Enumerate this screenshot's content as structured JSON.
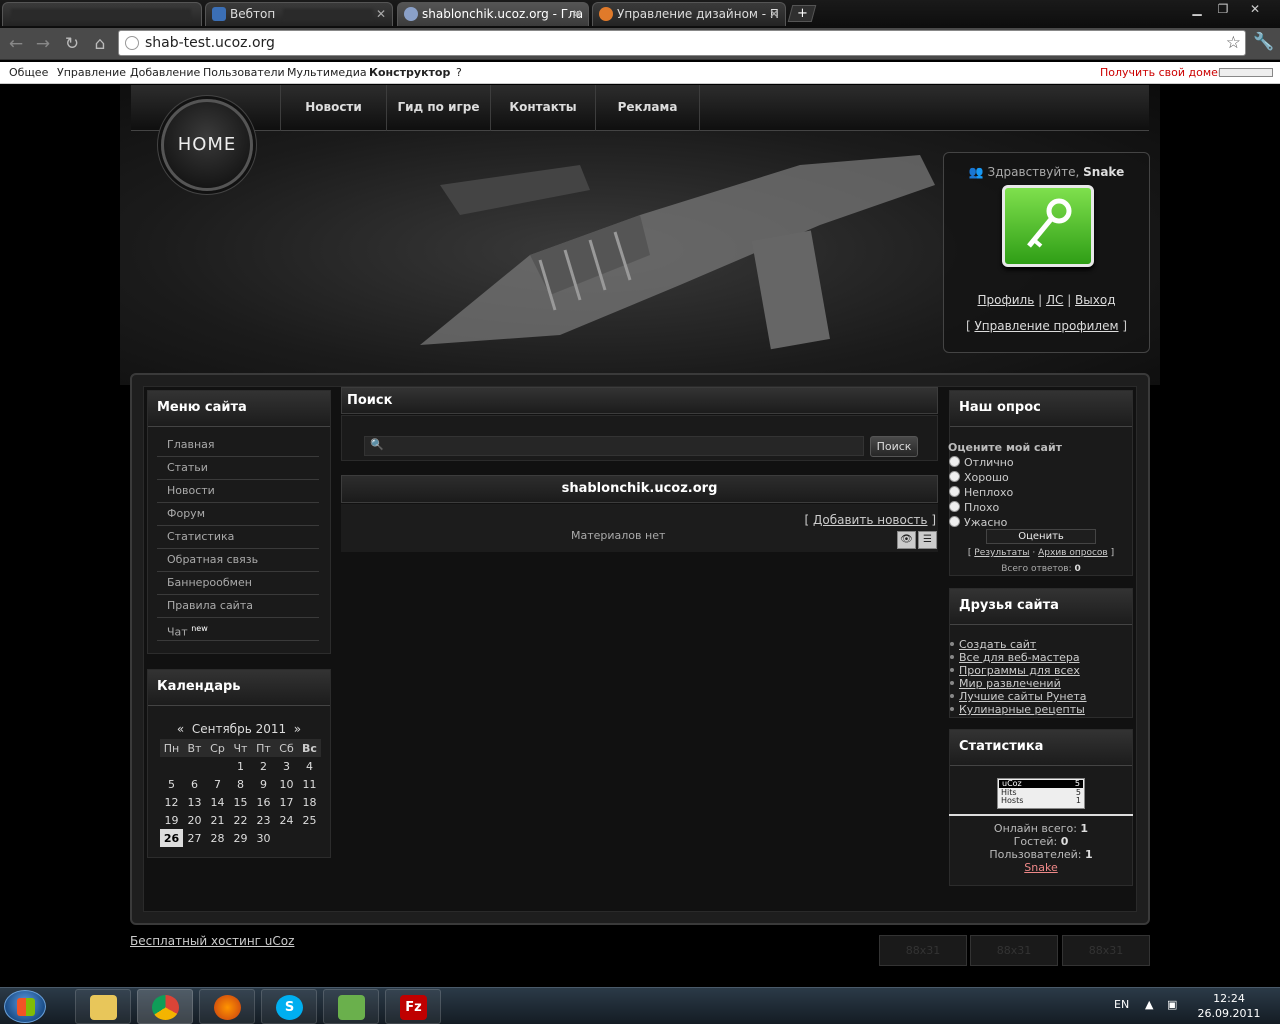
{
  "browser": {
    "tabs": [
      {
        "label": "",
        "active": false
      },
      {
        "label": "Вебтоп",
        "active": false
      },
      {
        "label": "shablonchik.ucoz.org - Гла",
        "active": true
      },
      {
        "label": "Управление дизайном - П",
        "active": false
      }
    ],
    "new_tab": "+",
    "url": "shab-test.ucoz.org"
  },
  "ucozbar": {
    "items": [
      "Общее",
      "Управление",
      "Добавление",
      "Пользователи",
      "Мультимедиа",
      "Конструктор",
      "?"
    ],
    "domain_link": "Получить свой домен"
  },
  "nav": {
    "home": "HOME",
    "items": [
      "Новости",
      "Гид по игре",
      "Контакты",
      "Реклама"
    ]
  },
  "login": {
    "greeting": "Здравствуйте,",
    "username": "Snake",
    "profile": "Профиль",
    "pm": "ЛС",
    "logout": "Выход",
    "manage": "Управление профилем"
  },
  "menu": {
    "title": "Меню сайта",
    "items": [
      "Главная",
      "Статьи",
      "Новости",
      "Форум",
      "Статистика",
      "Обратная связь",
      "Баннерообмен",
      "Правила сайта",
      "Чат"
    ],
    "chat_badge": "new"
  },
  "calendar": {
    "title": "Календарь",
    "prev": "«",
    "month": "Сентябрь 2011",
    "next": "»",
    "dow": [
      "Пн",
      "Вт",
      "Ср",
      "Чт",
      "Пт",
      "Сб",
      "Вс"
    ],
    "weeks": [
      [
        "",
        "",
        "",
        "1",
        "2",
        "3",
        "4"
      ],
      [
        "5",
        "6",
        "7",
        "8",
        "9",
        "10",
        "11"
      ],
      [
        "12",
        "13",
        "14",
        "15",
        "16",
        "17",
        "18"
      ],
      [
        "19",
        "20",
        "21",
        "22",
        "23",
        "24",
        "25"
      ],
      [
        "26",
        "27",
        "28",
        "29",
        "30",
        "",
        ""
      ]
    ],
    "today": "26"
  },
  "search": {
    "title": "Поиск",
    "button": "Поиск",
    "value": ""
  },
  "news": {
    "title": "shablonchik.ucoz.org",
    "add": "Добавить новость",
    "empty": "Материалов нет"
  },
  "poll": {
    "title": "Наш опрос",
    "question": "Оцените мой сайт",
    "options": [
      "Отлично",
      "Хорошо",
      "Неплохо",
      "Плохо",
      "Ужасно"
    ],
    "vote": "Оценить",
    "results": "Результаты",
    "archive": "Архив опросов",
    "total_label": "Всего ответов:",
    "total": "0"
  },
  "friends": {
    "title": "Друзья сайта",
    "links": [
      "Создать сайт",
      "Все для веб-мастера",
      "Программы для всех",
      "Мир развлечений",
      "Лучшие сайты Рунета",
      "Кулинарные рецепты"
    ]
  },
  "stats": {
    "title": "Статистика",
    "counter": {
      "brand": "uCoz",
      "top": "5",
      "hits_label": "Hits",
      "hits": "5",
      "hosts_label": "Hosts",
      "hosts": "1"
    },
    "online_label": "Онлайн всего:",
    "online": "1",
    "guests_label": "Гостей:",
    "guests": "0",
    "users_label": "Пользователей:",
    "users": "1",
    "user": "Snake"
  },
  "footer": {
    "hosting": "Бесплатный хостинг uCoz",
    "badges": [
      "88x31",
      "88x31",
      "88x31"
    ]
  },
  "taskbar": {
    "lang": "EN",
    "time": "12:24",
    "date": "26.09.2011"
  }
}
